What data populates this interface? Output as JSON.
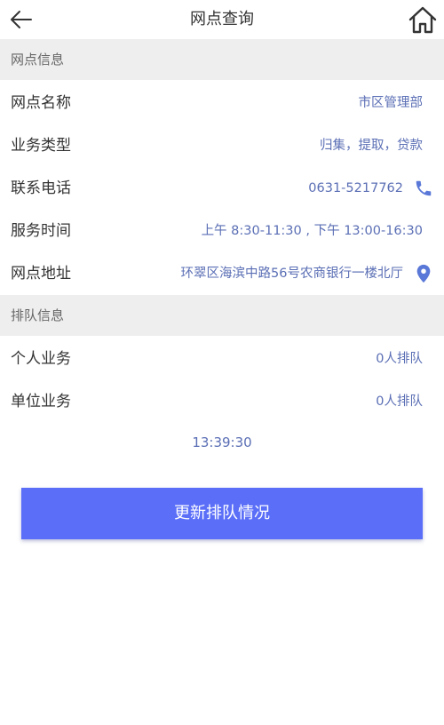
{
  "header": {
    "title": "网点查询",
    "back_icon": "back-arrow-icon",
    "home_icon": "home-icon"
  },
  "branch_info": {
    "section_title": "网点信息",
    "rows": [
      {
        "label": "网点名称",
        "value": "市区管理部"
      },
      {
        "label": "业务类型",
        "value": "归集，提取，贷款"
      },
      {
        "label": "联系电话",
        "value": "0631-5217762",
        "icon": "phone-icon"
      },
      {
        "label": "服务时间",
        "value": "上午 8:30-11:30 , 下午 13:00-16:30"
      },
      {
        "label": "网点地址",
        "value": "环翠区海滨中路56号农商银行一楼北厅",
        "icon": "location-pin-icon"
      }
    ]
  },
  "queue_info": {
    "section_title": "排队信息",
    "rows": [
      {
        "label": "个人业务",
        "value": "0人排队"
      },
      {
        "label": "单位业务",
        "value": "0人排队"
      }
    ],
    "updated_time": "13:39:30"
  },
  "actions": {
    "refresh_label": "更新排队情况"
  },
  "colors": {
    "accent": "#5a6ef8",
    "value_text": "#5b6fb5",
    "section_bg": "#eeeeee"
  }
}
